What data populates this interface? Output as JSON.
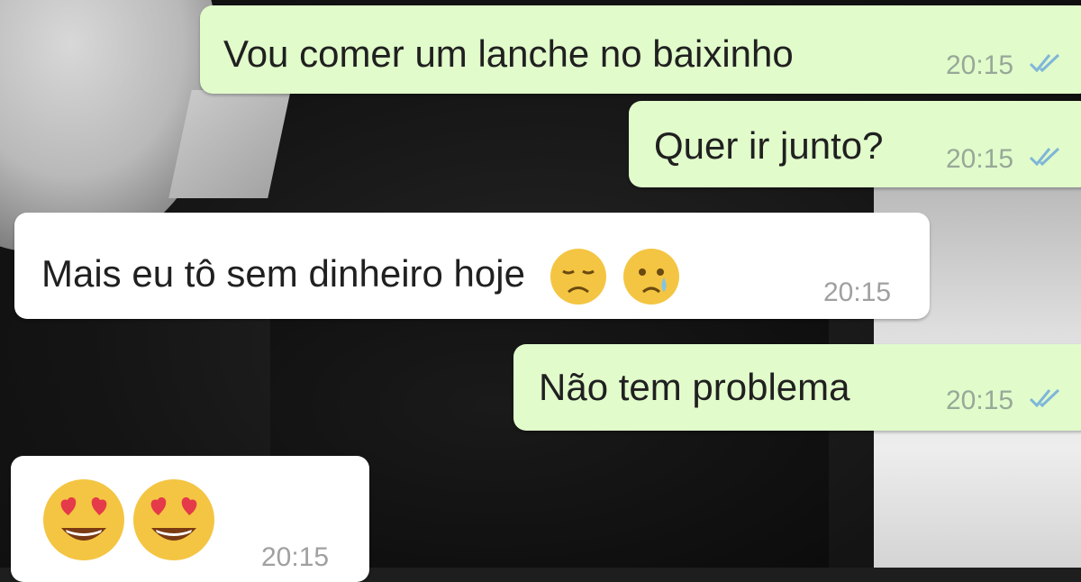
{
  "chat": {
    "messages": [
      {
        "direction": "out",
        "text": "Vou comer um lanche no baixinho",
        "time": "20:15",
        "status": "read"
      },
      {
        "direction": "out",
        "text": "Quer ir junto?",
        "time": "20:15",
        "status": "read"
      },
      {
        "direction": "in",
        "text": "Mais eu tô sem dinheiro hoje",
        "emojis": [
          "pensive-face",
          "crying-face"
        ],
        "time": "20:15"
      },
      {
        "direction": "out",
        "text": "Não tem problema",
        "time": "20:15",
        "status": "read"
      },
      {
        "direction": "in",
        "text": "",
        "emojis": [
          "heart-eyes-face",
          "heart-eyes-face"
        ],
        "time": "20:15"
      }
    ]
  },
  "colors": {
    "outgoing_bubble": "#e1fbcb",
    "incoming_bubble": "#ffffff",
    "read_tick": "#7fb6d9",
    "timestamp": "#98a898"
  }
}
